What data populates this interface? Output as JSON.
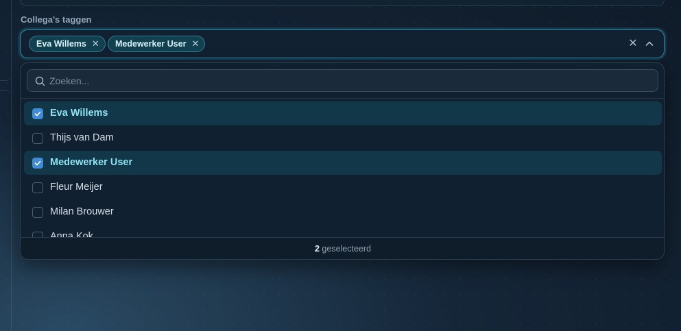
{
  "field": {
    "label": "Collega's taggen"
  },
  "chips": [
    {
      "label": "Eva Willems",
      "remove": "✕"
    },
    {
      "label": "Medewerker User",
      "remove": "✕"
    }
  ],
  "controls": {
    "clear": "✕",
    "toggle_icon": "chevron-up-icon"
  },
  "search": {
    "placeholder": "Zoeken...",
    "value": ""
  },
  "options": [
    {
      "label": "Eva Willems",
      "checked": true
    },
    {
      "label": "Thijs van Dam",
      "checked": false
    },
    {
      "label": "Medewerker User",
      "checked": true
    },
    {
      "label": "Fleur Meijer",
      "checked": false
    },
    {
      "label": "Milan Brouwer",
      "checked": false
    },
    {
      "label": "Anna Kok",
      "checked": false
    }
  ],
  "footer": {
    "count": "2",
    "text": "geselecteerd"
  },
  "colors": {
    "accent": "#2f8fa7",
    "checkbox_checked": "#3f8bd6",
    "selected_text": "#8fe3f4",
    "selected_row": "#113748"
  }
}
